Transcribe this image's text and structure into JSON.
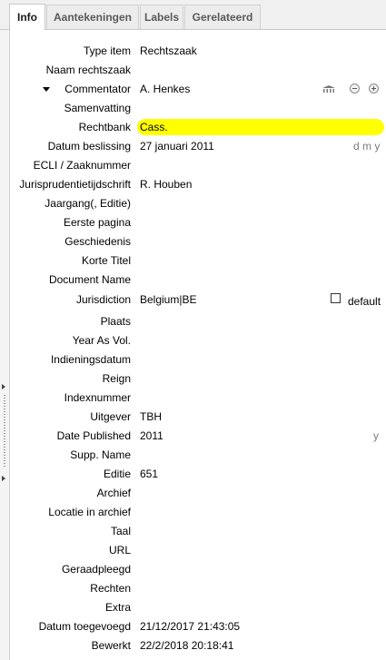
{
  "tabs": [
    {
      "label": "Info",
      "active": true
    },
    {
      "label": "Aantekeningen",
      "active": false
    },
    {
      "label": "Labels",
      "active": false
    },
    {
      "label": "Gerelateerd",
      "active": false
    }
  ],
  "colors": {
    "highlight": "#ffff00",
    "hint": "#7a7a7a"
  },
  "fields": {
    "item_type": {
      "label": "Type item",
      "value": "Rechtszaak"
    },
    "case_name": {
      "label": "Naam rechtszaak",
      "value": ""
    },
    "commentator": {
      "label": "Commentator",
      "value": "A. Henkes"
    },
    "abstract": {
      "label": "Samenvatting",
      "value": ""
    },
    "court": {
      "label": "Rechtbank",
      "value": "Cass."
    },
    "date_decided": {
      "label": "Datum beslissing",
      "value": "27 januari 2011",
      "hint": "d m y"
    },
    "ecli": {
      "label": "ECLI / Zaaknummer",
      "value": ""
    },
    "reporter": {
      "label": "Jurisprudentietijdschrift",
      "value": "R. Houben"
    },
    "volume": {
      "label": "Jaargang(, Editie)",
      "value": ""
    },
    "first_page": {
      "label": "Eerste pagina",
      "value": ""
    },
    "history": {
      "label": "Geschiedenis",
      "value": ""
    },
    "short_title": {
      "label": "Korte Titel",
      "value": ""
    },
    "doc_name": {
      "label": "Document Name",
      "value": ""
    },
    "jurisdiction": {
      "label": "Jurisdiction",
      "value": "Belgium|BE",
      "checkbox_label": "default",
      "checked": false
    },
    "place": {
      "label": "Plaats",
      "value": ""
    },
    "year_as_vol": {
      "label": "Year As Vol.",
      "value": ""
    },
    "filing_date": {
      "label": "Indieningsdatum",
      "value": ""
    },
    "reign": {
      "label": "Reign",
      "value": ""
    },
    "index_number": {
      "label": "Indexnummer",
      "value": ""
    },
    "publisher": {
      "label": "Uitgever",
      "value": "TBH"
    },
    "date_pub": {
      "label": "Date Published",
      "value": "2011",
      "hint": "y"
    },
    "supp_name": {
      "label": "Supp. Name",
      "value": ""
    },
    "edition": {
      "label": "Editie",
      "value": "651"
    },
    "archive": {
      "label": "Archief",
      "value": ""
    },
    "archive_loc": {
      "label": "Locatie in archief",
      "value": ""
    },
    "language": {
      "label": "Taal",
      "value": ""
    },
    "url": {
      "label": "URL",
      "value": ""
    },
    "accessed": {
      "label": "Geraadpleegd",
      "value": ""
    },
    "rights": {
      "label": "Rechten",
      "value": ""
    },
    "extra": {
      "label": "Extra",
      "value": ""
    },
    "date_added": {
      "label": "Datum toegevoegd",
      "value": "21/12/2017 21:43:05"
    },
    "modified": {
      "label": "Bewerkt",
      "value": "22/2/2018 20:18:41"
    }
  }
}
